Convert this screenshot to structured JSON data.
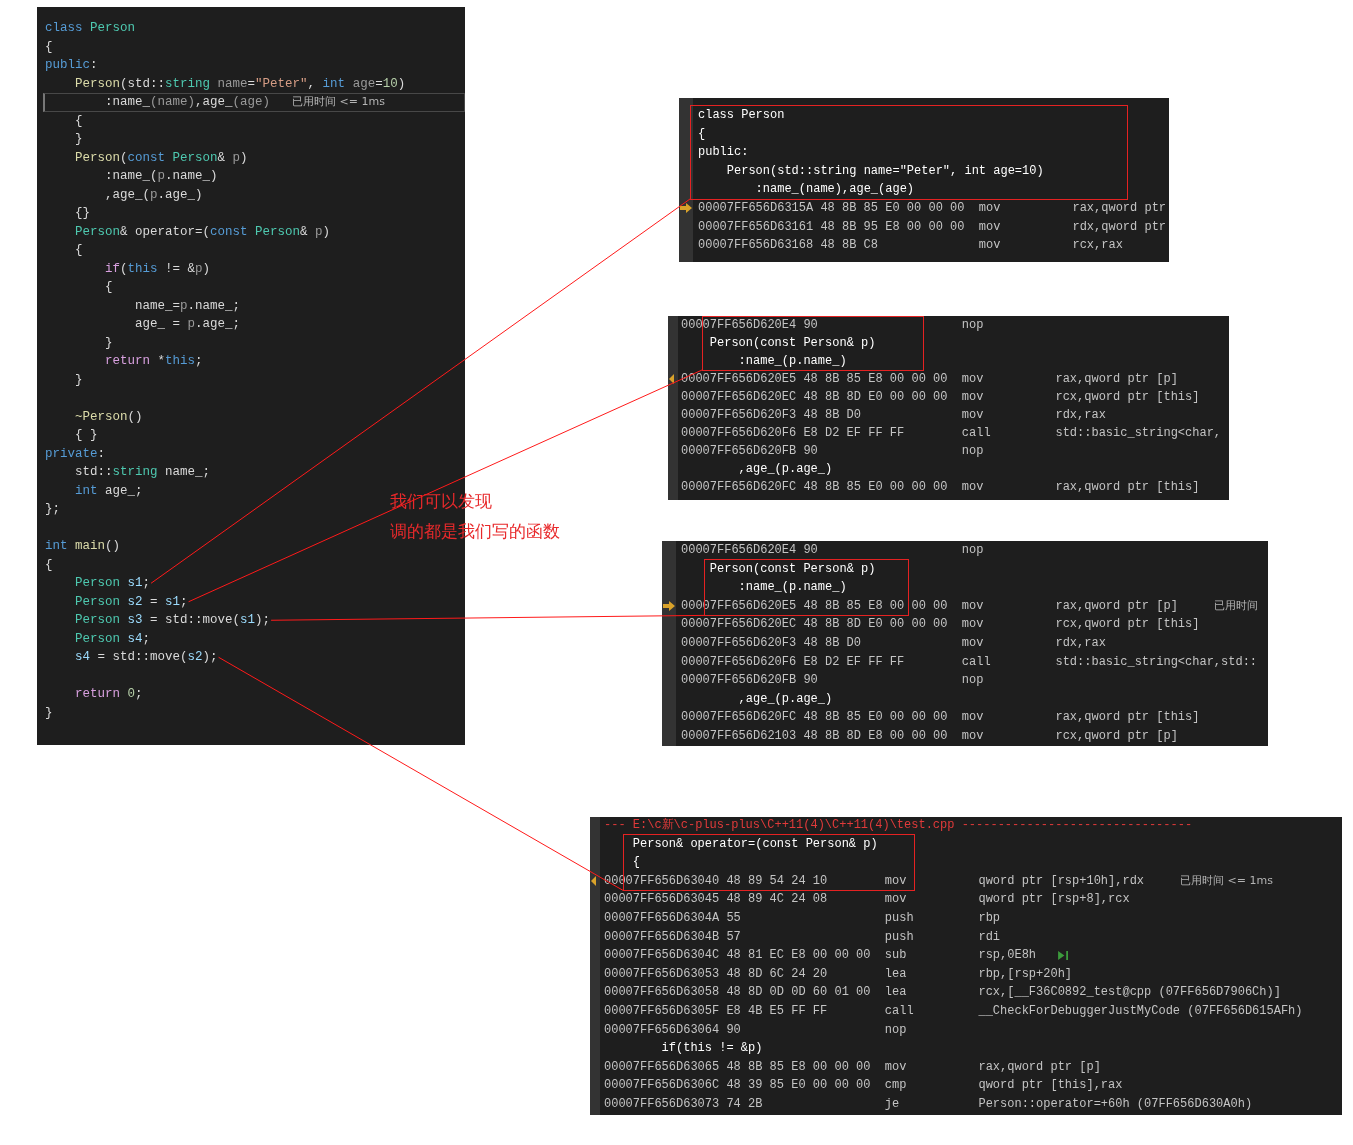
{
  "code": {
    "lines": [
      {
        "tokens": [
          {
            "kind": "keyword",
            "text": "class "
          },
          {
            "kind": "type",
            "text": "Person"
          }
        ],
        "current": false,
        "callout": false
      },
      {
        "tokens": [
          {
            "kind": "plain",
            "text": "{"
          }
        ],
        "current": false,
        "callout": false
      },
      {
        "tokens": [
          {
            "kind": "keyword",
            "text": "public"
          },
          {
            "kind": "plain",
            "text": ":"
          }
        ],
        "current": false,
        "callout": false
      },
      {
        "tokens": [
          {
            "kind": "function",
            "text": "    Person"
          },
          {
            "kind": "plain",
            "text": "(std::"
          },
          {
            "kind": "type",
            "text": "string"
          },
          {
            "kind": "param",
            "text": " name"
          },
          {
            "kind": "plain",
            "text": "="
          },
          {
            "kind": "string",
            "text": "\"Peter\""
          },
          {
            "kind": "plain",
            "text": ", "
          },
          {
            "kind": "keyword",
            "text": "int"
          },
          {
            "kind": "param",
            "text": " age"
          },
          {
            "kind": "plain",
            "text": "="
          },
          {
            "kind": "number",
            "text": "10"
          },
          {
            "kind": "plain",
            "text": ")"
          }
        ],
        "current": false,
        "callout": false
      },
      {
        "tokens": [
          {
            "kind": "plain",
            "text": "        :name_"
          },
          {
            "kind": "param",
            "text": "(name)"
          },
          {
            "kind": "plain",
            "text": ",age_"
          },
          {
            "kind": "param",
            "text": "(age)"
          }
        ],
        "hint": "已用时间 <= 1ms",
        "current": true,
        "callout": false
      },
      {
        "tokens": [
          {
            "kind": "plain",
            "text": "    {"
          }
        ],
        "current": false,
        "callout": false
      },
      {
        "tokens": [
          {
            "kind": "plain",
            "text": "    }"
          }
        ],
        "current": false,
        "callout": false
      },
      {
        "tokens": [
          {
            "kind": "function",
            "text": "    Person"
          },
          {
            "kind": "plain",
            "text": "("
          },
          {
            "kind": "keyword",
            "text": "const"
          },
          {
            "kind": "type",
            "text": " Person"
          },
          {
            "kind": "plain",
            "text": "& "
          },
          {
            "kind": "param",
            "text": "p"
          },
          {
            "kind": "plain",
            "text": ")"
          }
        ],
        "current": false,
        "callout": false
      },
      {
        "tokens": [
          {
            "kind": "plain",
            "text": "        :name_("
          },
          {
            "kind": "param",
            "text": "p"
          },
          {
            "kind": "plain",
            "text": ".name_)"
          }
        ],
        "current": false,
        "callout": false
      },
      {
        "tokens": [
          {
            "kind": "plain",
            "text": "        ,age_("
          },
          {
            "kind": "param",
            "text": "p"
          },
          {
            "kind": "plain",
            "text": ".age_)"
          }
        ],
        "current": false,
        "callout": false
      },
      {
        "tokens": [
          {
            "kind": "plain",
            "text": "    {}"
          }
        ],
        "current": false,
        "callout": false
      },
      {
        "tokens": [
          {
            "kind": "type",
            "text": "    Person"
          },
          {
            "kind": "plain",
            "text": "& operator=("
          },
          {
            "kind": "keyword",
            "text": "const"
          },
          {
            "kind": "type",
            "text": " Person"
          },
          {
            "kind": "plain",
            "text": "& "
          },
          {
            "kind": "param",
            "text": "p"
          },
          {
            "kind": "plain",
            "text": ")"
          }
        ],
        "current": false,
        "callout": false
      },
      {
        "tokens": [
          {
            "kind": "plain",
            "text": "    {"
          }
        ],
        "current": false,
        "callout": false
      },
      {
        "tokens": [
          {
            "kind": "control",
            "text": "        if"
          },
          {
            "kind": "plain",
            "text": "("
          },
          {
            "kind": "keyword",
            "text": "this"
          },
          {
            "kind": "plain",
            "text": " != &"
          },
          {
            "kind": "param",
            "text": "p"
          },
          {
            "kind": "plain",
            "text": ")"
          }
        ],
        "current": false,
        "callout": false
      },
      {
        "tokens": [
          {
            "kind": "plain",
            "text": "        {"
          }
        ],
        "current": false,
        "callout": false
      },
      {
        "tokens": [
          {
            "kind": "plain",
            "text": "            name_="
          },
          {
            "kind": "param",
            "text": "p"
          },
          {
            "kind": "plain",
            "text": ".name_;"
          }
        ],
        "current": false,
        "callout": false
      },
      {
        "tokens": [
          {
            "kind": "plain",
            "text": "            age_ = "
          },
          {
            "kind": "param",
            "text": "p"
          },
          {
            "kind": "plain",
            "text": ".age_;"
          }
        ],
        "current": false,
        "callout": false
      },
      {
        "tokens": [
          {
            "kind": "plain",
            "text": "        }"
          }
        ],
        "current": false,
        "callout": false
      },
      {
        "tokens": [
          {
            "kind": "control",
            "text": "        return"
          },
          {
            "kind": "plain",
            "text": " *"
          },
          {
            "kind": "keyword",
            "text": "this"
          },
          {
            "kind": "plain",
            "text": ";"
          }
        ],
        "current": false,
        "callout": false
      },
      {
        "tokens": [
          {
            "kind": "plain",
            "text": "    }"
          }
        ],
        "current": false,
        "callout": false
      },
      {
        "current": false,
        "callout": false
      },
      {
        "tokens": [
          {
            "kind": "function",
            "text": "    ~Person"
          },
          {
            "kind": "plain",
            "text": "()"
          }
        ],
        "current": false,
        "callout": false
      },
      {
        "tokens": [
          {
            "kind": "plain",
            "text": "    { }"
          }
        ],
        "current": false,
        "callout": false
      },
      {
        "tokens": [
          {
            "kind": "keyword",
            "text": "private"
          },
          {
            "kind": "plain",
            "text": ":"
          }
        ],
        "current": false,
        "callout": false
      },
      {
        "tokens": [
          {
            "kind": "plain",
            "text": "    std::"
          },
          {
            "kind": "type",
            "text": "string"
          },
          {
            "kind": "plain",
            "text": " name_;"
          }
        ],
        "current": false,
        "callout": false
      },
      {
        "tokens": [
          {
            "kind": "keyword",
            "text": "    int"
          },
          {
            "kind": "plain",
            "text": " age_;"
          }
        ],
        "current": false,
        "callout": false
      },
      {
        "tokens": [
          {
            "kind": "plain",
            "text": "};"
          }
        ],
        "current": false,
        "callout": false
      },
      {
        "current": false,
        "callout": false
      },
      {
        "tokens": [
          {
            "kind": "keyword",
            "text": "int"
          },
          {
            "kind": "function",
            "text": " main"
          },
          {
            "kind": "plain",
            "text": "()"
          }
        ],
        "current": false,
        "callout": false
      },
      {
        "tokens": [
          {
            "kind": "plain",
            "text": "{"
          }
        ],
        "current": false,
        "callout": false
      },
      {
        "tokens": [
          {
            "kind": "type",
            "text": "    Person"
          },
          {
            "kind": "variable",
            "text": " s1"
          },
          {
            "kind": "plain",
            "text": ";"
          }
        ],
        "current": false,
        "callout": true
      },
      {
        "tokens": [
          {
            "kind": "type",
            "text": "    Person"
          },
          {
            "kind": "variable",
            "text": " s2"
          },
          {
            "kind": "plain",
            "text": " = "
          },
          {
            "kind": "variable",
            "text": "s1"
          },
          {
            "kind": "plain",
            "text": ";"
          }
        ],
        "current": false,
        "callout": true
      },
      {
        "tokens": [
          {
            "kind": "type",
            "text": "    Person"
          },
          {
            "kind": "variable",
            "text": " s3"
          },
          {
            "kind": "plain",
            "text": " = std::move("
          },
          {
            "kind": "variable",
            "text": "s1"
          },
          {
            "kind": "plain",
            "text": ");"
          }
        ],
        "current": false,
        "callout": true
      },
      {
        "tokens": [
          {
            "kind": "type",
            "text": "    Person"
          },
          {
            "kind": "variable",
            "text": " s4"
          },
          {
            "kind": "plain",
            "text": ";"
          }
        ],
        "current": false,
        "callout": false
      },
      {
        "tokens": [
          {
            "kind": "variable",
            "text": "    s4"
          },
          {
            "kind": "plain",
            "text": " = std::move("
          },
          {
            "kind": "variable",
            "text": "s2"
          },
          {
            "kind": "plain",
            "text": ");"
          }
        ],
        "current": false,
        "callout": true
      },
      {
        "current": false,
        "callout": false
      },
      {
        "tokens": [
          {
            "kind": "control",
            "text": "    return"
          },
          {
            "kind": "number",
            "text": " 0"
          },
          {
            "kind": "plain",
            "text": ";"
          }
        ],
        "current": false,
        "callout": false
      },
      {
        "tokens": [
          {
            "kind": "plain",
            "text": "}"
          }
        ],
        "current": false,
        "callout": false
      }
    ]
  },
  "annotation": {
    "lines": [
      "我们可以发现",
      "调的都是我们写的函数"
    ]
  },
  "panels": [
    {
      "lines": [
        {
          "kind": "source",
          "text": "class Person",
          "boxed": true
        },
        {
          "kind": "source",
          "text": "{",
          "boxed": true
        },
        {
          "kind": "source",
          "text": "public:",
          "boxed": true
        },
        {
          "kind": "source",
          "text": "    Person(std::string name=\"Peter\", int age=10)",
          "boxed": true
        },
        {
          "kind": "source",
          "text": "        :name_(name),age_(age)",
          "boxed": true
        },
        {
          "kind": "asm",
          "address": "00007FF656D6315A",
          "bytes": "48 8B 85 E0 00 00 00",
          "op": "mov",
          "args": "rax,qword ptr",
          "marker": {
            "kind": "arrow"
          },
          "boxed": false
        },
        {
          "kind": "asm",
          "address": "00007FF656D63161",
          "bytes": "48 8B 95 E8 00 00 00",
          "op": "mov",
          "args": "rdx,qword ptr",
          "boxed": false
        },
        {
          "kind": "asm",
          "address": "00007FF656D63168",
          "bytes": "48 8B C8",
          "op": "mov",
          "args": "rcx,rax",
          "boxed": false
        }
      ]
    },
    {
      "lines": [
        {
          "kind": "asm",
          "address": "00007FF656D620E4",
          "bytes": "90",
          "op": "nop",
          "boxed": true
        },
        {
          "kind": "source",
          "text": "    Person(const Person& p)",
          "boxed": true
        },
        {
          "kind": "source",
          "text": "        :name_(p.name_)",
          "boxed": true
        },
        {
          "kind": "asm",
          "address": "00007FF656D620E5",
          "bytes": "48 8B 85 E8 00 00 00",
          "op": "mov",
          "args": "rax,qword ptr [p]",
          "marker": {
            "kind": "diamond"
          },
          "boxed": false
        },
        {
          "kind": "asm",
          "address": "00007FF656D620EC",
          "bytes": "48 8B 8D E0 00 00 00",
          "op": "mov",
          "args": "rcx,qword ptr [this]",
          "boxed": false
        },
        {
          "kind": "asm",
          "address": "00007FF656D620F3",
          "bytes": "48 8B D0",
          "op": "mov",
          "args": "rdx,rax",
          "boxed": false
        },
        {
          "kind": "asm",
          "address": "00007FF656D620F6",
          "bytes": "E8 D2 EF FF FF",
          "op": "call",
          "args": "std::basic_string<char,",
          "boxed": false
        },
        {
          "kind": "asm",
          "address": "00007FF656D620FB",
          "bytes": "90",
          "op": "nop",
          "boxed": false
        },
        {
          "kind": "source",
          "text": "        ,age_(p.age_)",
          "boxed": false
        },
        {
          "kind": "asm",
          "address": "00007FF656D620FC",
          "bytes": "48 8B 85 E0 00 00 00",
          "op": "mov",
          "args": "rax,qword ptr [this]",
          "boxed": false
        }
      ]
    },
    {
      "lines": [
        {
          "kind": "asm",
          "address": "00007FF656D620E4",
          "bytes": "90",
          "op": "nop",
          "boxed": false
        },
        {
          "kind": "source",
          "text": "    Person(const Person& p)",
          "boxed": true
        },
        {
          "kind": "source",
          "text": "        :name_(p.name_)",
          "boxed": true
        },
        {
          "kind": "asm",
          "address": "00007FF656D620E5",
          "bytes": "48 8B 85 E8 00 00 00",
          "op": "mov",
          "args": "rax,qword ptr [p]",
          "marker": {
            "kind": "arrow"
          },
          "hint": "已用时间",
          "boxed": true
        },
        {
          "kind": "asm",
          "address": "00007FF656D620EC",
          "bytes": "48 8B 8D E0 00 00 00",
          "op": "mov",
          "args": "rcx,qword ptr [this]",
          "boxed": false
        },
        {
          "kind": "asm",
          "address": "00007FF656D620F3",
          "bytes": "48 8B D0",
          "op": "mov",
          "args": "rdx,rax",
          "boxed": false
        },
        {
          "kind": "asm",
          "address": "00007FF656D620F6",
          "bytes": "E8 D2 EF FF FF",
          "op": "call",
          "args": "std::basic_string<char,std::",
          "boxed": false
        },
        {
          "kind": "asm",
          "address": "00007FF656D620FB",
          "bytes": "90",
          "op": "nop",
          "boxed": false
        },
        {
          "kind": "source",
          "text": "        ,age_(p.age_)",
          "boxed": false
        },
        {
          "kind": "asm",
          "address": "00007FF656D620FC",
          "bytes": "48 8B 85 E0 00 00 00",
          "op": "mov",
          "args": "rax,qword ptr [this]",
          "boxed": false
        },
        {
          "kind": "asm",
          "address": "00007FF656D62103",
          "bytes": "48 8B 8D E8 00 00 00",
          "op": "mov",
          "args": "rcx,qword ptr [p]",
          "boxed": false
        }
      ]
    },
    {
      "lines": [
        {
          "kind": "file",
          "text": "--- E:\\c新\\c-plus-plus\\C++11(4)\\C++11(4)\\test.cpp --------------------------------",
          "boxed": false
        },
        {
          "kind": "source",
          "text": "    Person& operator=(const Person& p)",
          "boxed": true
        },
        {
          "kind": "source",
          "text": "    {",
          "boxed": true
        },
        {
          "kind": "asm",
          "address": "00007FF656D63040",
          "bytes": "48 89 54 24 10",
          "op": "mov",
          "args": "qword ptr [rsp+10h],rdx",
          "marker": {
            "kind": "diamond"
          },
          "hint": "已用时间 <= 1ms",
          "boxed": true
        },
        {
          "kind": "asm",
          "address": "00007FF656D63045",
          "bytes": "48 89 4C 24 08",
          "op": "mov",
          "args": "qword ptr [rsp+8],rcx",
          "boxed": false
        },
        {
          "kind": "asm",
          "address": "00007FF656D6304A",
          "bytes": "55",
          "op": "push",
          "args": "rbp",
          "boxed": false
        },
        {
          "kind": "asm",
          "address": "00007FF656D6304B",
          "bytes": "57",
          "op": "push",
          "args": "rdi",
          "boxed": false
        },
        {
          "kind": "asm",
          "address": "00007FF656D6304C",
          "bytes": "48 81 EC E8 00 00 00",
          "op": "sub",
          "args": "rsp,0E8h",
          "run_to_cursor": true,
          "boxed": false
        },
        {
          "kind": "asm",
          "address": "00007FF656D63053",
          "bytes": "48 8D 6C 24 20",
          "op": "lea",
          "args": "rbp,[rsp+20h]",
          "boxed": false
        },
        {
          "kind": "asm",
          "address": "00007FF656D63058",
          "bytes": "48 8D 0D 0D 60 01 00",
          "op": "lea",
          "args": "rcx,[__F36C0892_test@cpp (07FF656D7906Ch)]",
          "boxed": false
        },
        {
          "kind": "asm",
          "address": "00007FF656D6305F",
          "bytes": "E8 4B E5 FF FF",
          "op": "call",
          "args": "__CheckForDebuggerJustMyCode (07FF656D615AFh)",
          "boxed": false
        },
        {
          "kind": "asm",
          "address": "00007FF656D63064",
          "bytes": "90",
          "op": "nop",
          "boxed": false
        },
        {
          "kind": "source",
          "text": "        if(this != &p)",
          "boxed": false
        },
        {
          "kind": "asm",
          "address": "00007FF656D63065",
          "bytes": "48 8B 85 E8 00 00 00",
          "op": "mov",
          "args": "rax,qword ptr [p]",
          "boxed": false
        },
        {
          "kind": "asm",
          "address": "00007FF656D6306C",
          "bytes": "48 39 85 E0 00 00 00",
          "op": "cmp",
          "args": "qword ptr [this],rax",
          "boxed": false
        },
        {
          "kind": "asm",
          "address": "00007FF656D63073",
          "bytes": "74 2B",
          "op": "je",
          "args": "Person::operator=+60h (07FF656D630A0h)",
          "boxed": false
        }
      ]
    }
  ]
}
